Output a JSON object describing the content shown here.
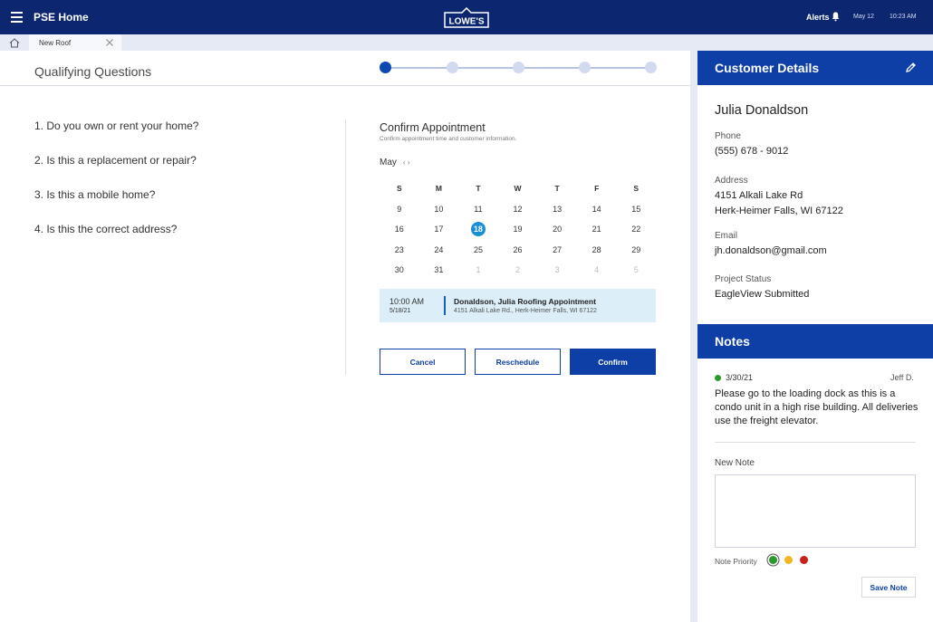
{
  "header": {
    "menu_icon": "hamburger-icon",
    "app_title": "PSE Home",
    "logo_text": "LOWE'S",
    "alerts_label": "Alerts",
    "alerts_icon": "bell-icon",
    "date": "May 12",
    "time": "10:23 AM"
  },
  "tabs": {
    "home_icon": "home-icon",
    "active_tab": "New Roof",
    "close_icon": "close-icon"
  },
  "main": {
    "title": "Qualifying Questions",
    "stepper": {
      "total_steps": 5,
      "current_step": 1
    },
    "questions": [
      "1. Do you own or rent your home?",
      "2.  Is this a replacement or repair?",
      "3.  Is this a mobile home?",
      "4.  Is this the correct address?"
    ],
    "appointment": {
      "title": "Confirm Appointment",
      "subtitle": "Confirm appointment time and customer information.",
      "month": "May",
      "weekdays": [
        "S",
        "M",
        "T",
        "W",
        "T",
        "F",
        "S"
      ],
      "weeks": [
        [
          "9",
          "10",
          "11",
          "12",
          "13",
          "14",
          "15"
        ],
        [
          "16",
          "17",
          "18",
          "19",
          "20",
          "21",
          "22"
        ],
        [
          "23",
          "24",
          "25",
          "26",
          "27",
          "28",
          "29"
        ],
        [
          "30",
          "31",
          "1",
          "2",
          "3",
          "4",
          "5"
        ]
      ],
      "selected_day": "18",
      "card": {
        "time": "10:00 AM",
        "date": "5/18/21",
        "title": "Donaldson, Julia  Roofing Appointment",
        "address": "4151 Alkali Lake Rd., Herk-Heimer Falls, WI  67122"
      },
      "buttons": {
        "cancel": "Cancel",
        "reschedule": "Reschedule",
        "confirm": "Confirm"
      }
    }
  },
  "customer": {
    "header": "Customer Details",
    "edit_icon": "pencil-icon",
    "name": "Julia Donaldson",
    "phone_label": "Phone",
    "phone": "(555) 678 - 9012",
    "address_label": "Address",
    "address_line1": "4151 Alkali Lake Rd",
    "address_line2": "Herk-Heimer Falls, WI  67122",
    "email_label": "Email",
    "email": "jh.donaldson@gmail.com",
    "status_label": "Project Status",
    "status": "EagleView Submitted"
  },
  "notes": {
    "header": "Notes",
    "items": [
      {
        "date": "3/30/21",
        "author": "Jeff D.",
        "priority_color": "#2a9a2a",
        "text": "Please go to the loading dock as this is a condo unit in a high rise building. All deliveries use the freight elevator."
      }
    ],
    "new_note_label": "New Note",
    "new_note_value": "",
    "priority_label": "Note Priority",
    "priority_colors": [
      "#2a9a2a",
      "#f2b521",
      "#c8211e"
    ],
    "save_label": "Save Note"
  },
  "colors": {
    "navy": "#0c2670",
    "brand_blue": "#0d3fa6",
    "accent_blue": "#1a8ed6"
  }
}
